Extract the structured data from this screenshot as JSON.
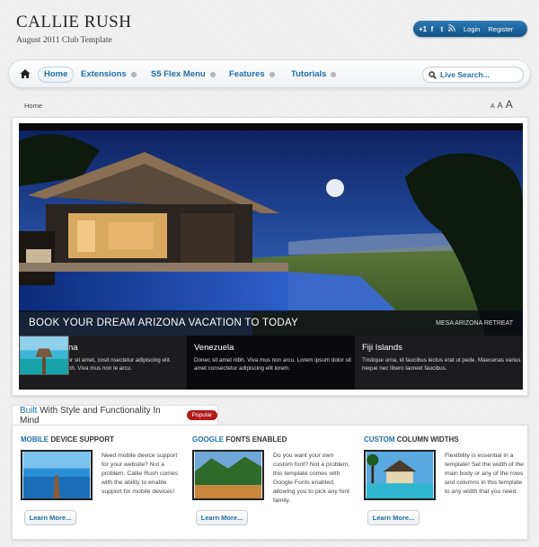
{
  "site": {
    "title": "CALLIE RUSH",
    "subtitle": "August 2011 Club Template"
  },
  "topbar": {
    "social": [
      {
        "label": "+1",
        "icon": "google-plus-icon"
      },
      {
        "label": "f",
        "icon": "facebook-icon"
      },
      {
        "label": "t",
        "icon": "twitter-icon"
      },
      {
        "label": "rss",
        "icon": "rss-icon"
      }
    ],
    "login": "Login",
    "register": "Register"
  },
  "nav": {
    "items": [
      "Home",
      "Extensions",
      "S5 Flex Menu",
      "Features",
      "Tutorials"
    ],
    "search_placeholder": "Live Search..."
  },
  "breadcrumb": "Home",
  "font_sizes": [
    "A",
    "A",
    "A"
  ],
  "hero": {
    "caption": "BOOK YOUR DREAM ARIZONA VACATION TO TODAY",
    "caption_right": "MESA ARIZONA RETREAT",
    "thumbs": [
      {
        "title": "Mesa Arizona",
        "desc": "Lorem ipsum dolor sit amet, cosit nsectetur adipiscing elit. Donec sit ame nibh. Viva mus non le arcu."
      },
      {
        "title": "Venezuela",
        "desc": "Donec sit amet nibh. Viva mus non arcu. Lorem ipsum dolor sit amet consectetur adipiscing elit lorem."
      },
      {
        "title": "Fiji Islands",
        "desc": "Tristique urna, id faucibus lectus erat ut pede. Maecenas varius neque nec libero laoreet faucibus."
      }
    ]
  },
  "section": {
    "title_accent": "Built",
    "title_rest": "With Style and Functionality In Mind",
    "badge": "Popular"
  },
  "features": [
    {
      "accent": "MOBILE",
      "rest": "DEVICE SUPPORT",
      "text": "Need mobile device support for your website? Not a problem. Callie Rush comes with the ability to enable support for mobile devices!",
      "button": "Learn More..."
    },
    {
      "accent": "GOOGLE",
      "rest": "FONTS ENABLED",
      "text": "Do you want your own custom font? Not a problem, this template comes with Google Fonts enabled, allowing you to pick any font family.",
      "button": "Learn More..."
    },
    {
      "accent": "CUSTOM",
      "rest": "COLUMN WIDTHS",
      "text": "Flexibility is essential in a template! Set the width of the main body or any of the rows and columns in this template to any width that you need.",
      "button": "Learn More..."
    }
  ],
  "colors": {
    "accent": "#1f6fa8",
    "topbar": "#0f5286",
    "badge": "#b31b1b"
  }
}
